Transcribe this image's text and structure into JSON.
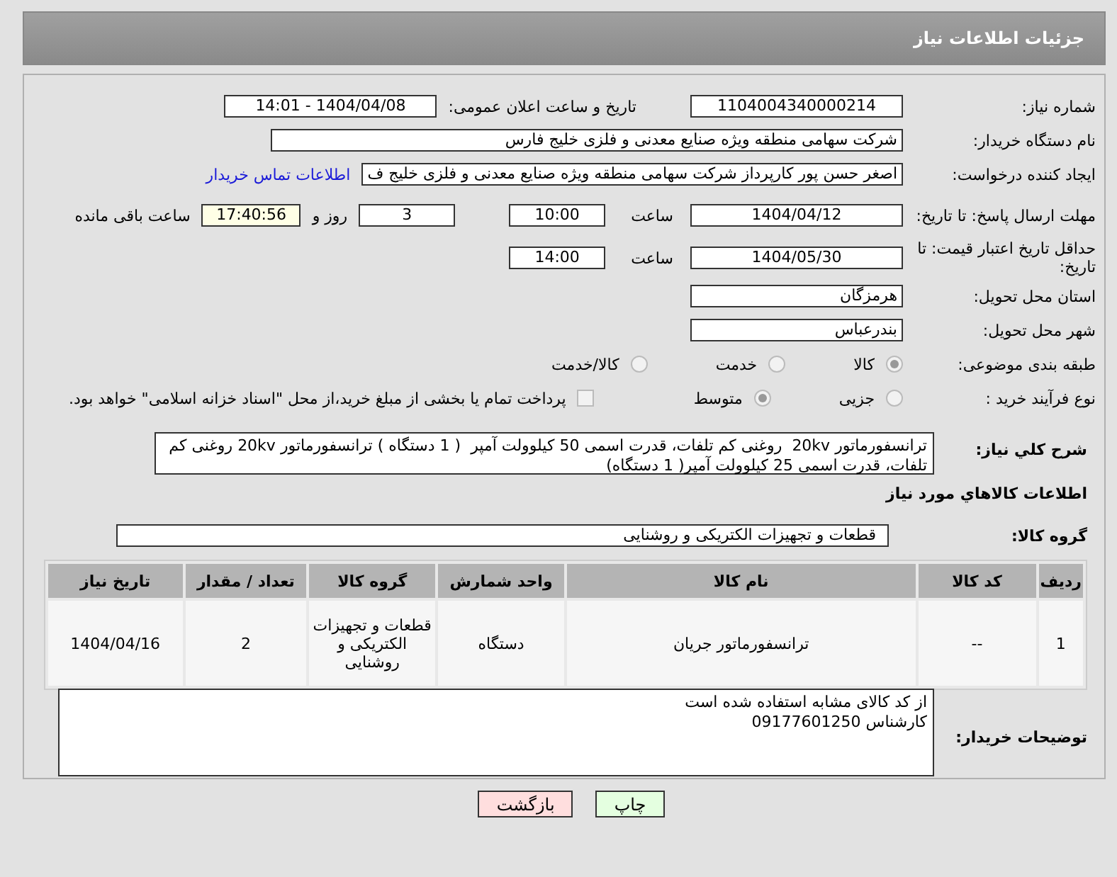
{
  "header": {
    "title": "جزئیات اطلاعات نیاز"
  },
  "need_number": {
    "label": "شماره نیاز:",
    "value": "1104004340000214"
  },
  "announce": {
    "label": "تاریخ و ساعت اعلان عمومی:",
    "value": "1404/04/08 - 14:01"
  },
  "buyer": {
    "label": "نام دستگاه خریدار:",
    "value": "شرکت سهامی منطقه ویژه صنایع معدنی و فلزی خلیج فارس"
  },
  "requester": {
    "label": "ایجاد کننده درخواست:",
    "value": "اصغر حسن پور کارپرداز شرکت سهامی منطقه ویژه صنایع معدنی و فلزی خلیج ف",
    "link": "اطلاعات تماس خریدار"
  },
  "deadline": {
    "label": "مهلت ارسال پاسخ: تا تاریخ:",
    "date": "1404/04/12",
    "time_label": "ساعت",
    "time": "10:00",
    "days": "3",
    "days_label": "روز و",
    "remaining": "17:40:56",
    "remaining_label": "ساعت باقی مانده"
  },
  "validity": {
    "label": "حداقل تاریخ اعتبار قیمت: تا تاریخ:",
    "date": "1404/05/30",
    "time_label": "ساعت",
    "time": "14:00"
  },
  "province": {
    "label": "استان محل تحویل:",
    "value": "هرمزگان"
  },
  "city": {
    "label": "شهر محل تحویل:",
    "value": "بندرعباس"
  },
  "category": {
    "label": "طبقه بندی موضوعی:",
    "options": [
      {
        "label": "کالا",
        "selected": true
      },
      {
        "label": "خدمت",
        "selected": false
      },
      {
        "label": "کالا/خدمت",
        "selected": false
      }
    ]
  },
  "process": {
    "label": "نوع فرآیند خرید :",
    "options": [
      {
        "label": "جزیی",
        "selected": false
      },
      {
        "label": "متوسط",
        "selected": true
      }
    ],
    "payment": {
      "label": "پرداخت تمام یا بخشی از مبلغ خرید،از محل \"اسناد خزانه اسلامی\" خواهد بود.",
      "checked": false
    }
  },
  "description": {
    "label": "شرح کلي نیاز:",
    "text": "ترانسفورماتور 20kv  روغنی کم تلفات، قدرت اسمی 50 کیلوولت آمپر  ( 1 دستگاه ) ترانسفورماتور 20kv روغنی کم تلفات، قدرت اسمی 25 کیلوولت آمپر( 1 دستگاه)"
  },
  "goods_heading": "اطلاعات کالاهاي مورد نیاز",
  "goods_group": {
    "label": "گروه کالا:",
    "value": "قطعات و تجهیزات الکتریکی و روشنایی"
  },
  "table": {
    "columns": [
      "ردیف",
      "کد کالا",
      "نام کالا",
      "واحد شمارش",
      "گروه کالا",
      "تعداد / مقدار",
      "تاریخ نیاز"
    ],
    "rows": [
      [
        "1",
        "--",
        "ترانسفورماتور جریان",
        "دستگاه",
        "قطعات و تجهیزات الکتریکی و روشنایی",
        "2",
        "1404/04/16"
      ]
    ]
  },
  "notes": {
    "label": "توضیحات خریدار:",
    "text": "از کد کالای مشابه استفاده شده است\nکارشناس 09177601250"
  },
  "buttons": [
    {
      "label": "چاپ",
      "kind": "print"
    },
    {
      "label": "بازگشت",
      "kind": "back"
    }
  ]
}
